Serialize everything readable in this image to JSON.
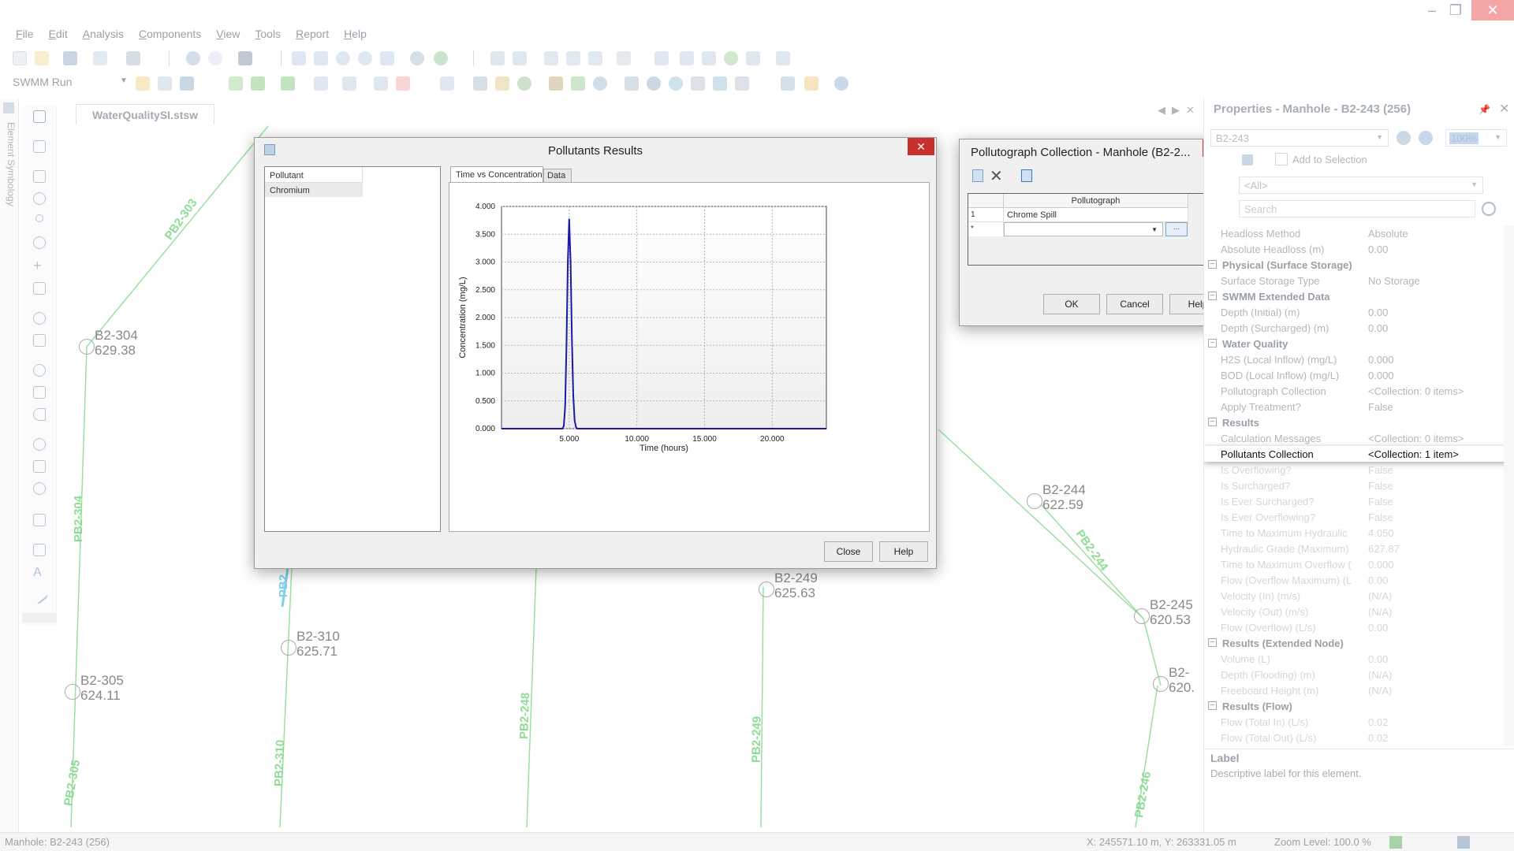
{
  "menu": [
    "File",
    "Edit",
    "Analysis",
    "Components",
    "View",
    "Tools",
    "Report",
    "Help"
  ],
  "toolbar": {
    "run_label": "SWMM Run"
  },
  "sidebar": {
    "symbology_label": "Element Symbology"
  },
  "document_tab": "WaterQualitySI.stsw",
  "map": {
    "nodes": [
      {
        "id": "B2-304",
        "value": "629.38"
      },
      {
        "id": "B2-305",
        "value": "624.11"
      },
      {
        "id": "B2-310",
        "value": "625.71"
      },
      {
        "id": "B2-249",
        "value": "625.63"
      },
      {
        "id": "B2-244",
        "value": "622.59"
      },
      {
        "id": "B2-245",
        "value": "620.53"
      },
      {
        "id": "B2-",
        "value": "620."
      }
    ],
    "pipes": [
      "PB2-303",
      "PB2-304",
      "PB2-310",
      "PB2-248",
      "PB2-249",
      "PB2-244",
      "PB2-246",
      "PB2-305",
      "PB2"
    ]
  },
  "pollutants_dialog": {
    "title": "Pollutants Results",
    "list_header": "Pollutant",
    "items": [
      "Chromium"
    ],
    "tabs": [
      "Time vs Concentration",
      "Data"
    ],
    "close_label": "Close",
    "help_label": "Help"
  },
  "chart_data": {
    "type": "line",
    "xlabel": "Time (hours)",
    "ylabel": "Concentration (mg/L)",
    "xlim": [
      0,
      24
    ],
    "ylim": [
      0,
      4.0
    ],
    "x_ticks": [
      "5.000",
      "10.000",
      "15.000",
      "20.000"
    ],
    "y_ticks": [
      "0.000",
      "0.500",
      "1.000",
      "1.500",
      "2.000",
      "2.500",
      "3.000",
      "3.500",
      "4.000"
    ],
    "grid": true,
    "series": [
      {
        "color": "#1a1aa6",
        "x": [
          0,
          4.5,
          4.6,
          4.7,
          4.8,
          4.9,
          5.0,
          5.1,
          5.2,
          5.3,
          5.4,
          5.5,
          5.6,
          6.0,
          24
        ],
        "y": [
          0,
          0,
          0.05,
          0.4,
          1.5,
          3.0,
          3.78,
          3.0,
          1.6,
          0.6,
          0.15,
          0.03,
          0,
          0,
          0
        ]
      }
    ]
  },
  "pollutograph_dialog": {
    "title": "Pollutograph Collection - Manhole (B2-2...",
    "column_header": "Pollutograph",
    "rows": [
      {
        "index": "1",
        "value": "Chrome Spill"
      }
    ],
    "new_row_marker": "*",
    "ellipsis": "...",
    "ok_label": "OK",
    "cancel_label": "Cancel",
    "help_label": "Help"
  },
  "properties": {
    "title": "Properties - Manhole - B2-243 (256)",
    "element_selector": "B2-243",
    "zoom": "100%",
    "add_to_selection": "Add to Selection",
    "filter": "<All>",
    "search_placeholder": "Search",
    "rows": [
      {
        "kind": "prop",
        "name": "Headloss Method",
        "value": "Absolute"
      },
      {
        "kind": "prop",
        "name": "Absolute Headloss (m)",
        "value": "0.00"
      },
      {
        "kind": "cat",
        "name": "Physical (Surface Storage)",
        "value": ""
      },
      {
        "kind": "prop",
        "name": "Surface Storage Type",
        "value": "No Storage"
      },
      {
        "kind": "cat",
        "name": "SWMM Extended Data",
        "value": ""
      },
      {
        "kind": "prop",
        "name": "Depth (Initial) (m)",
        "value": "0.00"
      },
      {
        "kind": "prop",
        "name": "Depth (Surcharged) (m)",
        "value": "0.00"
      },
      {
        "kind": "cat",
        "name": "Water Quality",
        "value": ""
      },
      {
        "kind": "prop",
        "name": "H2S (Local Inflow) (mg/L)",
        "value": "0.000"
      },
      {
        "kind": "prop",
        "name": "BOD (Local Inflow) (mg/L)",
        "value": "0.000"
      },
      {
        "kind": "prop",
        "name": "Pollutograph Collection",
        "value": "<Collection: 0 items>"
      },
      {
        "kind": "prop",
        "name": "Apply Treatment?",
        "value": "False"
      },
      {
        "kind": "cat",
        "name": "Results",
        "value": ""
      },
      {
        "kind": "prop",
        "name": "Calculation Messages",
        "value": "<Collection: 0 items>"
      },
      {
        "kind": "sel",
        "name": "Pollutants Collection",
        "value": "<Collection: 1 item>"
      },
      {
        "kind": "dim",
        "name": "Is Overflowing?",
        "value": "False"
      },
      {
        "kind": "dim",
        "name": "Is Surcharged?",
        "value": "False"
      },
      {
        "kind": "dim",
        "name": "Is Ever Surcharged?",
        "value": "False"
      },
      {
        "kind": "dim",
        "name": "Is Ever Overflowing?",
        "value": "False"
      },
      {
        "kind": "dim",
        "name": "Time to Maximum Hydraulic",
        "value": "4.050"
      },
      {
        "kind": "dim",
        "name": "Hydraulic Grade (Maximum)",
        "value": "627.87"
      },
      {
        "kind": "dim",
        "name": "Time to Maximum Overflow (",
        "value": "0.000"
      },
      {
        "kind": "dim",
        "name": "Flow (Overflow Maximum) (L",
        "value": "0.00"
      },
      {
        "kind": "dim",
        "name": "Velocity (In) (m/s)",
        "value": "(N/A)"
      },
      {
        "kind": "dim",
        "name": "Velocity (Out) (m/s)",
        "value": "(N/A)"
      },
      {
        "kind": "dim",
        "name": "Flow (Overflow) (L/s)",
        "value": "0.00"
      },
      {
        "kind": "cat",
        "name": "Results (Extended Node)",
        "value": ""
      },
      {
        "kind": "dim",
        "name": "Volume (L)",
        "value": "0.00"
      },
      {
        "kind": "dim",
        "name": "Depth (Flooding) (m)",
        "value": "(N/A)"
      },
      {
        "kind": "dim",
        "name": "Freeboard Height (m)",
        "value": "(N/A)"
      },
      {
        "kind": "cat",
        "name": "Results (Flow)",
        "value": ""
      },
      {
        "kind": "dim",
        "name": "Flow (Total In) (L/s)",
        "value": "0.02"
      },
      {
        "kind": "dim",
        "name": "Flow (Total Out) (L/s)",
        "value": "0.02"
      }
    ],
    "label_title": "Label",
    "label_desc": "Descriptive label for this element."
  },
  "status": {
    "left": "Manhole:  B2-243 (256)",
    "coords": "X: 245571.10 m, Y: 263331.05 m",
    "zoom": "Zoom Level: 100.0 %"
  }
}
